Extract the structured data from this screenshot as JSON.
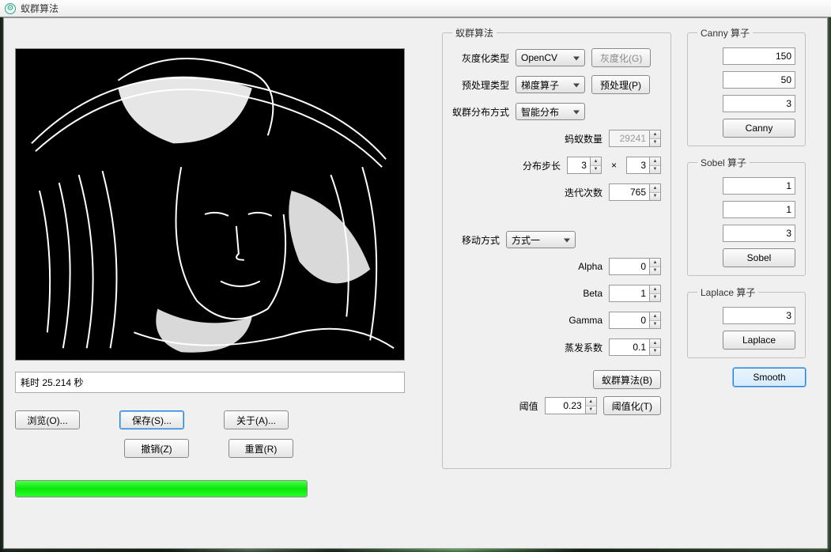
{
  "window": {
    "title": "蚁群算法"
  },
  "status": {
    "text": "耗时 25.214 秒"
  },
  "buttons": {
    "browse": "浏览(O)...",
    "save": "保存(S)...",
    "about": "关于(A)...",
    "undo": "撤销(Z)",
    "reset": "重置(R)"
  },
  "progress": {
    "percent": 100
  },
  "aco": {
    "legend": "蚁群算法",
    "gray_type_label": "灰度化类型",
    "gray_type_value": "OpenCV",
    "gray_button": "灰度化(G)",
    "pre_type_label": "预处理类型",
    "pre_type_value": "梯度算子",
    "pre_button": "预处理(P)",
    "dist_label": "蚁群分布方式",
    "dist_value": "智能分布",
    "ant_count_label": "蚂蚁数量",
    "ant_count_value": "29241",
    "step_label": "分布步长",
    "step_a": "3",
    "step_b": "3",
    "iter_label": "迭代次数",
    "iter_value": "765",
    "move_label": "移动方式",
    "move_value": "方式一",
    "alpha_label": "Alpha",
    "alpha_value": "0",
    "beta_label": "Beta",
    "beta_value": "1",
    "gamma_label": "Gamma",
    "gamma_value": "0",
    "evap_label": "蒸发系数",
    "evap_value": "0.1",
    "run_button": "蚁群算法(B)",
    "thresh_label": "阈值",
    "thresh_value": "0.23",
    "thresh_button": "阈值化(T)"
  },
  "canny": {
    "legend": "Canny 算子",
    "v1": "150",
    "v2": "50",
    "v3": "3",
    "button": "Canny"
  },
  "sobel": {
    "legend": "Sobel 算子",
    "v1": "1",
    "v2": "1",
    "v3": "3",
    "button": "Sobel"
  },
  "laplace": {
    "legend": "Laplace 算子",
    "v1": "3",
    "button": "Laplace"
  },
  "smooth": {
    "button": "Smooth"
  }
}
